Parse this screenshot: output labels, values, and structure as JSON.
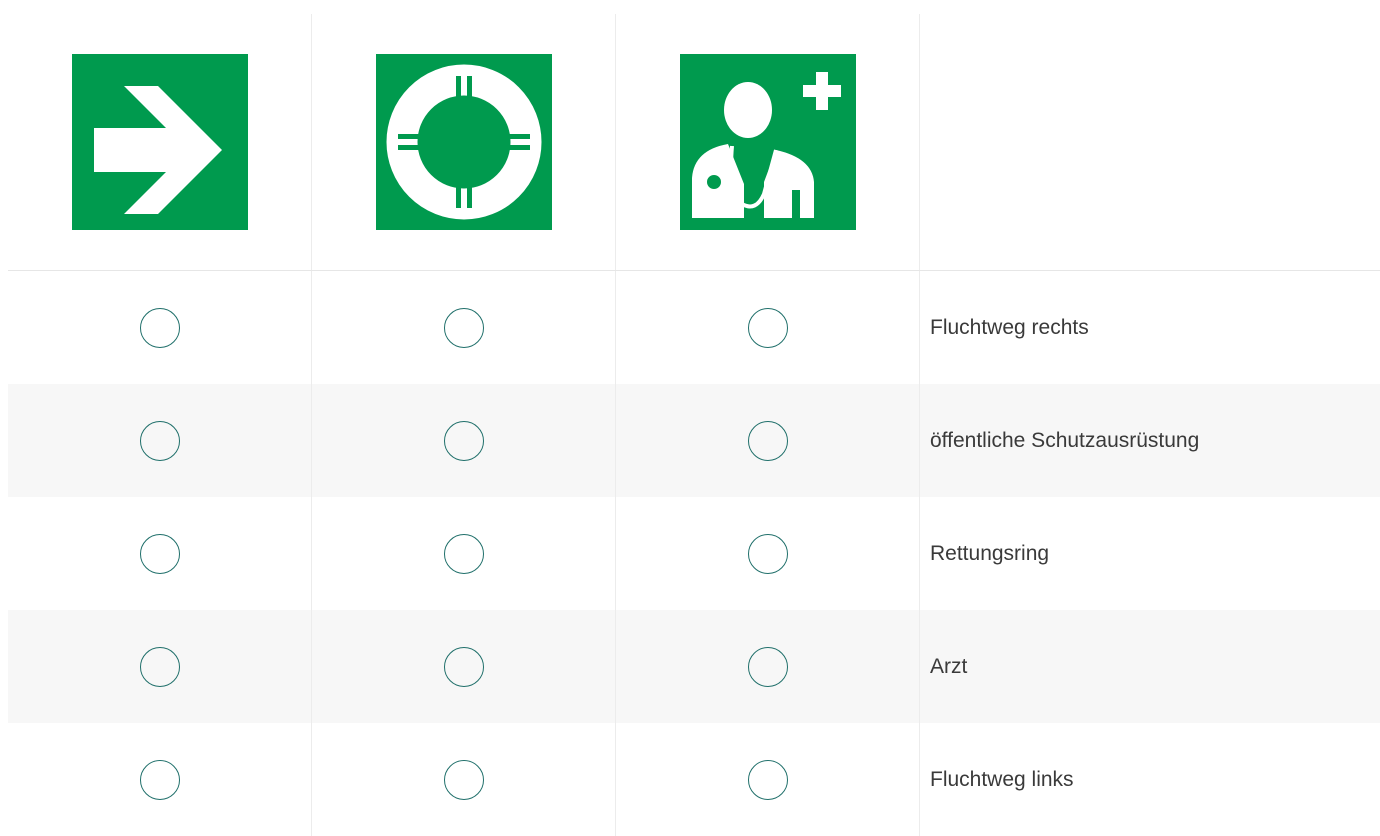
{
  "columns": [
    {
      "icon": "escape-route-right-arrow-icon",
      "color": "#009a4e"
    },
    {
      "icon": "lifebuoy-icon",
      "color": "#009a4e"
    },
    {
      "icon": "doctor-icon",
      "color": "#009a4e"
    }
  ],
  "rows": [
    {
      "label": "Fluchtweg rechts"
    },
    {
      "label": "öffentliche Schutzausrüstung"
    },
    {
      "label": "Rettungsring"
    },
    {
      "label": "Arzt"
    },
    {
      "label": "Fluchtweg links"
    }
  ],
  "colors": {
    "sign_green": "#009a4e",
    "radio_border": "#1f6f6a",
    "alt_row_bg": "#f7f7f7"
  }
}
